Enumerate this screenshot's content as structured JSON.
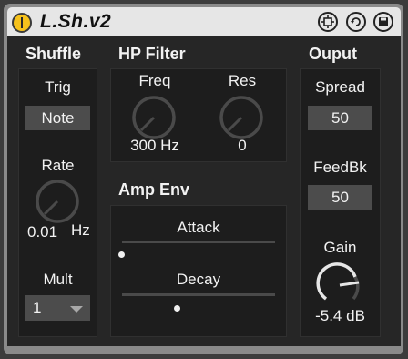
{
  "title": "L.Sh.v2",
  "shuffle": {
    "heading": "Shuffle",
    "trig_label": "Trig",
    "trig_value": "Note",
    "rate_label": "Rate",
    "rate_value": "0.01",
    "rate_unit": "Hz",
    "mult_label": "Mult",
    "mult_value": "1"
  },
  "hp_filter": {
    "heading": "HP Filter",
    "freq_label": "Freq",
    "freq_value": "300 Hz",
    "res_label": "Res",
    "res_value": "0"
  },
  "amp_env": {
    "heading": "Amp Env",
    "attack_label": "Attack",
    "decay_label": "Decay"
  },
  "output": {
    "heading": "Ouput",
    "spread_label": "Spread",
    "spread_value": "50",
    "feedbk_label": "FeedBk",
    "feedbk_value": "50",
    "gain_label": "Gain",
    "gain_value": "-5.4 dB"
  },
  "colors": {
    "power": "#f6c21c",
    "text": "#f2f2f2",
    "panel": "#1d1d1d",
    "field": "#4c4c4c"
  },
  "icons": [
    "power-icon",
    "hotswap-icon",
    "refresh-icon",
    "save-icon"
  ]
}
